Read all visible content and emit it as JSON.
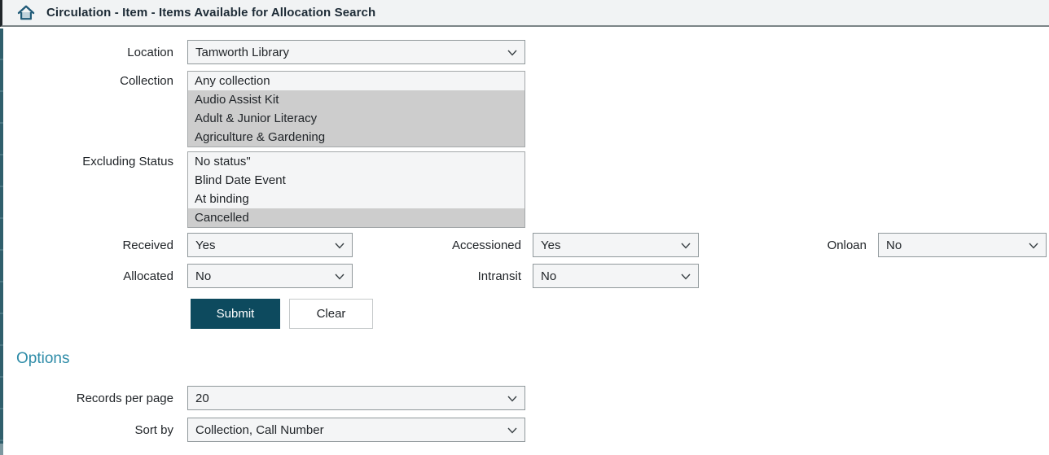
{
  "topbar": {
    "title": "Circulation - Item - Items Available for Allocation Search"
  },
  "form": {
    "location": {
      "label": "Location",
      "value": "Tamworth Library"
    },
    "collection": {
      "label": "Collection",
      "options": [
        {
          "label": "Any collection",
          "selected": false
        },
        {
          "label": "Audio Assist Kit",
          "selected": true
        },
        {
          "label": "Adult & Junior Literacy",
          "selected": true
        },
        {
          "label": "Agriculture & Gardening",
          "selected": true
        }
      ]
    },
    "excluding_status": {
      "label": "Excluding Status",
      "options": [
        {
          "label": "No status\"",
          "selected": false
        },
        {
          "label": "Blind Date Event",
          "selected": false
        },
        {
          "label": "At binding",
          "selected": false
        },
        {
          "label": "Cancelled",
          "selected": true
        }
      ]
    },
    "received": {
      "label": "Received",
      "value": "Yes"
    },
    "accessioned": {
      "label": "Accessioned",
      "value": "Yes"
    },
    "onloan": {
      "label": "Onloan",
      "value": "No"
    },
    "allocated": {
      "label": "Allocated",
      "value": "No"
    },
    "intransit": {
      "label": "Intransit",
      "value": "No"
    },
    "submit_label": "Submit",
    "clear_label": "Clear"
  },
  "options_section": {
    "heading": "Options",
    "records_per_page": {
      "label": "Records per page",
      "value": "20"
    },
    "sort_by": {
      "label": "Sort by",
      "value": "Collection, Call Number"
    }
  },
  "colors": {
    "submit_button": "#0d4a5e",
    "options_heading": "#2e8ca8",
    "selected_row": "#cdcdcd",
    "side_stripe": "#305f6c",
    "home_icon": "#1f5a78"
  }
}
